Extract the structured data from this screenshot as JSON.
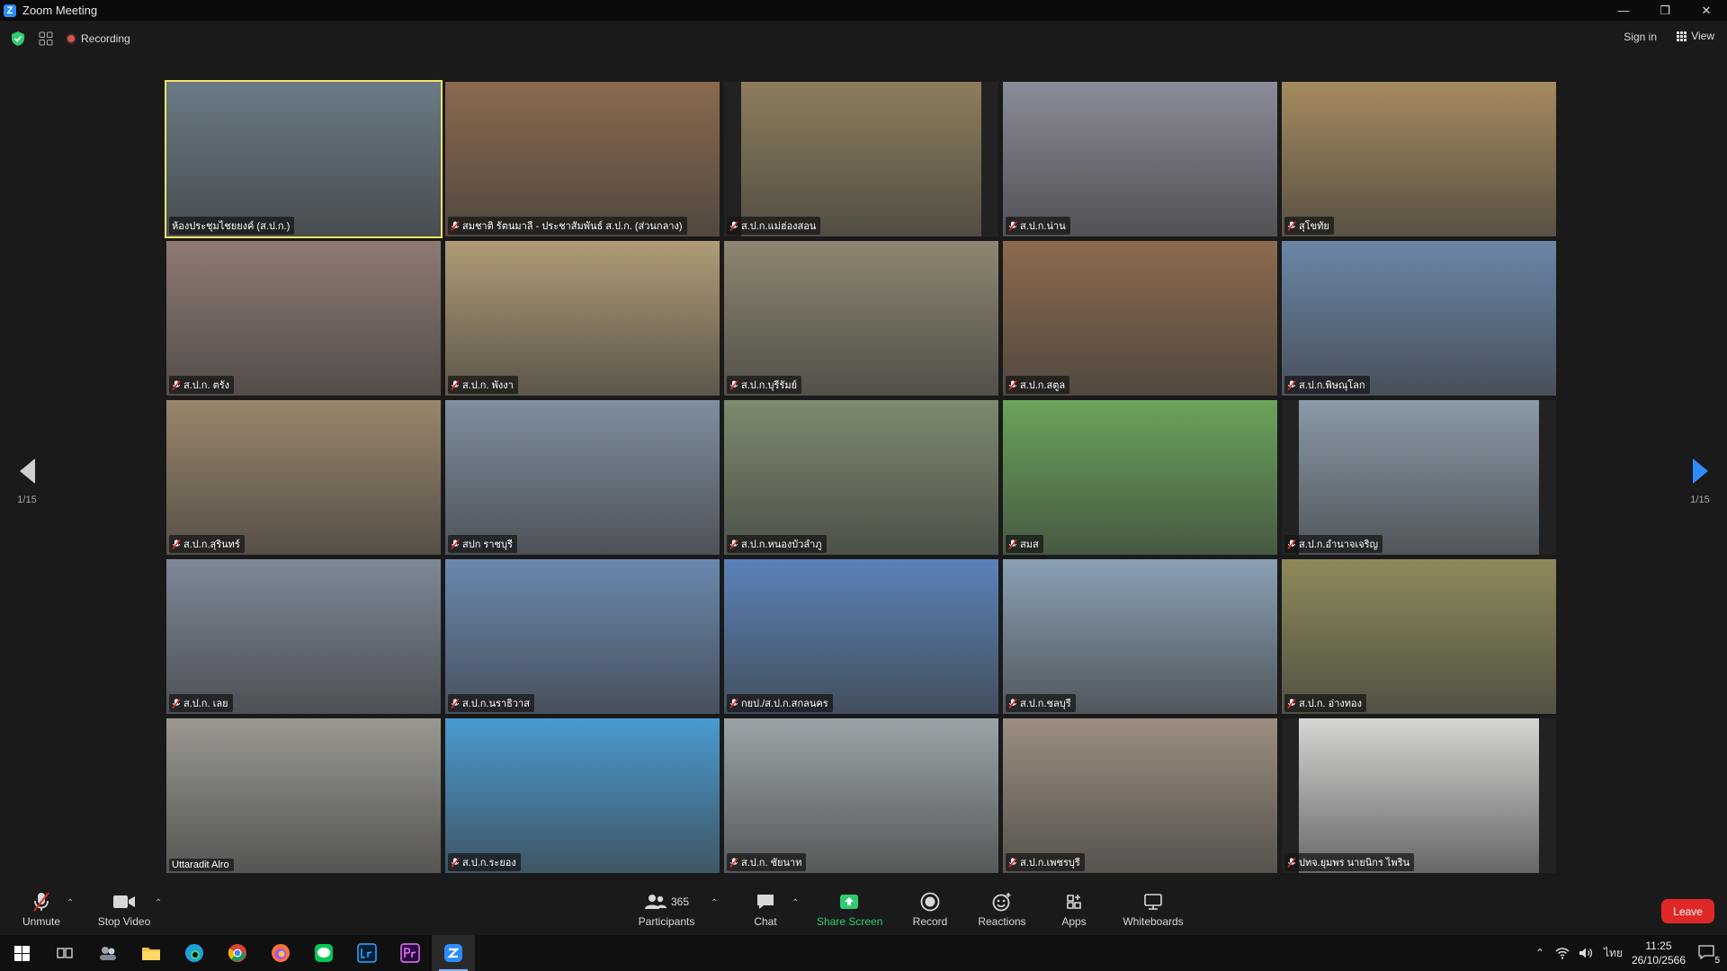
{
  "window": {
    "title": "Zoom Meeting",
    "minimize": "—",
    "restore": "❐",
    "close": "✕"
  },
  "topbar": {
    "recording_label": "Recording",
    "signin_label": "Sign in",
    "view_label": "View"
  },
  "pager": {
    "left_label": "1/15",
    "right_label": "1/15"
  },
  "tiles": [
    {
      "name": "ห้องประชุมไชยยงค์ (ส.ป.ก.)",
      "bg": "#6a7a86",
      "muted": false,
      "active": true
    },
    {
      "name": "สมชาติ รัตนมาลี - ประชาสัมพันธ์ ส.ป.ก. (ส่วนกลาง)",
      "bg": "#8a6a4e",
      "muted": true
    },
    {
      "name": "ส.ป.ก.แม่ฮ่องสอน",
      "bg": "#8d7d5c",
      "muted": true
    },
    {
      "name": "ส.ป.ก.น่าน",
      "bg": "#8a8c98",
      "muted": true
    },
    {
      "name": "สุโขทัย",
      "bg": "#a58a5e",
      "muted": true
    },
    {
      "name": "ส.ป.ก. ตรัง",
      "bg": "#8e7a72",
      "muted": true
    },
    {
      "name": "ส.ป.ก. พังงา",
      "bg": "#b09c76",
      "muted": true
    },
    {
      "name": "ส.ป.ก.บุรีรัมย์",
      "bg": "#8e8670",
      "muted": true
    },
    {
      "name": "ส.ป.ก.สตูล",
      "bg": "#8c6a4e",
      "muted": true
    },
    {
      "name": "ส.ป.ก.พิษณุโลก",
      "bg": "#6b86a8",
      "muted": true
    },
    {
      "name": "ส.ป.ก.สุรินทร์",
      "bg": "#9a866c",
      "muted": true
    },
    {
      "name": "สปก ราชบุรี",
      "bg": "#7f8ea0",
      "muted": true
    },
    {
      "name": "ส.ป.ก.หนองบัวลำภู",
      "bg": "#7c8a6e",
      "muted": true
    },
    {
      "name": "สมส",
      "bg": "#6aa45a",
      "muted": true
    },
    {
      "name": "ส.ป.ก.อำนาจเจริญ",
      "bg": "#8a9aa8",
      "muted": true
    },
    {
      "name": "ส.ป.ก. เลย",
      "bg": "#7d8898",
      "muted": true
    },
    {
      "name": "ส.ป.ก.นราธิวาส",
      "bg": "#6a88b0",
      "muted": true
    },
    {
      "name": "กยป./ส.ป.ก.สกลนคร",
      "bg": "#5a82b8",
      "muted": true
    },
    {
      "name": "ส.ป.ก.ชลบุรี",
      "bg": "#8aa0b4",
      "muted": true
    },
    {
      "name": "ส.ป.ก. อ่างทอง",
      "bg": "#8e8a5a",
      "muted": true
    },
    {
      "name": "Uttaradit Alro",
      "bg": "#9a9890",
      "muted": false
    },
    {
      "name": "ส.ป.ก.ระยอง",
      "bg": "#4a9ad0",
      "muted": true
    },
    {
      "name": "ส.ป.ก. ชัยนาท",
      "bg": "#9aa4a8",
      "muted": true
    },
    {
      "name": "ส.ป.ก.เพชรบุรี",
      "bg": "#9c8e80",
      "muted": true
    },
    {
      "name": "ปทจ.ยุมพร นายนิกร ไพริน",
      "bg": "#d8d6d2",
      "muted": true
    }
  ],
  "toolbar": {
    "unmute": "Unmute",
    "stop_video": "Stop Video",
    "participants": "Participants",
    "participants_count": "365",
    "chat": "Chat",
    "share_screen": "Share Screen",
    "record": "Record",
    "reactions": "Reactions",
    "apps": "Apps",
    "whiteboards": "Whiteboards",
    "leave": "Leave"
  },
  "taskbar": {
    "time": "11:25",
    "date": "26/10/2566",
    "language": "ไทย",
    "notification_count": "5"
  },
  "colors": {
    "accent_blue": "#2d8cff",
    "share_green": "#2ecc71",
    "leave_red": "#e02828",
    "active_speaker": "#f5e462"
  }
}
